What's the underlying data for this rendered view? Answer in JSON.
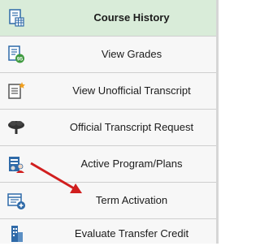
{
  "menu": {
    "items": [
      {
        "label": "Course History",
        "icon": "course-history-icon",
        "active": true
      },
      {
        "label": "View Grades",
        "icon": "grades-icon"
      },
      {
        "label": "View Unofficial Transcript",
        "icon": "transcript-icon"
      },
      {
        "label": "Official Transcript Request",
        "icon": "tree-icon"
      },
      {
        "label": "Active Program/Plans",
        "icon": "user-document-icon"
      },
      {
        "label": "Term Activation",
        "icon": "list-add-icon"
      },
      {
        "label": "Evaluate Transfer Credit",
        "icon": "building-icon"
      }
    ]
  },
  "colors": {
    "active_background": "#d9ecd9",
    "arrow": "#d11f1f",
    "icon_blue": "#2f6aa8",
    "icon_green": "#3f9a3f",
    "icon_orange": "#f2a01e"
  }
}
